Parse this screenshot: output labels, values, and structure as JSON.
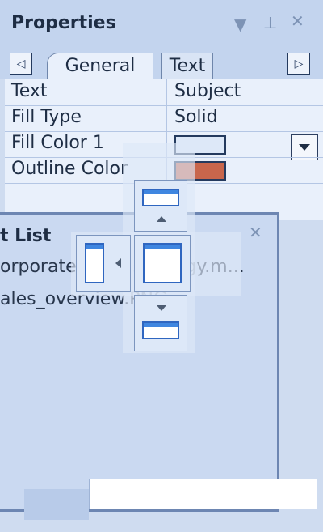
{
  "panel": {
    "title": "Properties",
    "tabs": [
      {
        "label": "General",
        "active": true
      },
      {
        "label": "Text",
        "active": false
      }
    ]
  },
  "properties": [
    {
      "name": "Text",
      "value": "Subject"
    },
    {
      "name": "Fill Type",
      "value": "Solid"
    },
    {
      "name": "Fill Color 1",
      "value": "",
      "swatch": "#dde8f8"
    },
    {
      "name": "Outline Color",
      "value": "",
      "swatch": "#c8664c"
    }
  ],
  "list_window": {
    "title": "t List",
    "items": [
      "orporate sales strategy.m...",
      "ales_overview.PNG"
    ]
  },
  "colors": {
    "panel_bg": "#cfdcf0",
    "header_bg": "#c3d4ee",
    "grid_bg": "#e9f0fb",
    "accent": "#3f86e0"
  },
  "icons": [
    "pin-icon",
    "close-icon",
    "chevron-down-icon",
    "scroll-left-icon",
    "scroll-right-icon",
    "dock-guide-icon"
  ]
}
